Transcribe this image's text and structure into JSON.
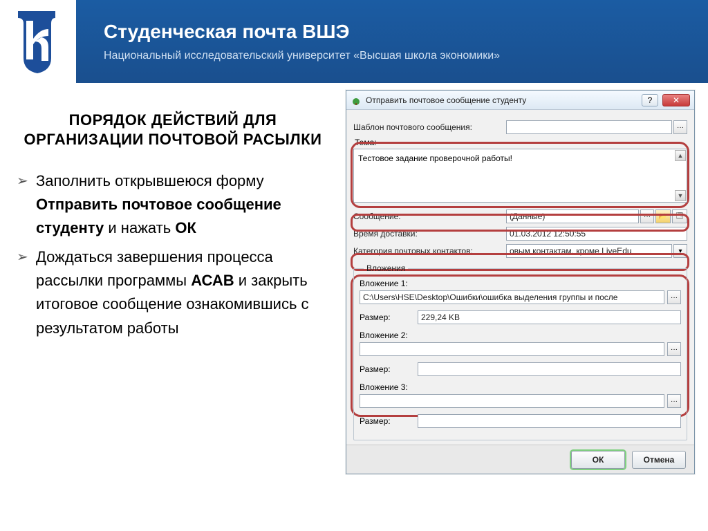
{
  "header": {
    "title": "Студенческая почта ВШЭ",
    "subtitle": "Национальный исследовательский университет «Высшая школа экономики»"
  },
  "left": {
    "heading": "ПОРЯДОК ДЕЙСТВИЙ ДЛЯ ОРГАНИЗАЦИИ ПОЧТОВОЙ РАСЫЛКИ",
    "bullet1_a": "Заполнить открывшеюся форму ",
    "bullet1_b": "Отправить почтовое сообщение студенту",
    "bullet1_c": " и нажать ",
    "bullet1_d": "ОК",
    "bullet2_a": "Дождаться завершения процесса рассылки программы ",
    "bullet2_b": "АСАВ",
    "bullet2_c": "  и закрыть итоговое сообщение ознакомившись с результатом работы"
  },
  "dialog": {
    "title": "Отправить почтовое сообщение студенту",
    "template_label": "Шаблон почтового сообщения:",
    "template_value": "",
    "tema_label": "Тема:",
    "tema_value": "Тестовое задание проверочной работы!",
    "message_label": "Сообщение:",
    "message_value": "(Данные)",
    "delivery_label": "Время доставки:",
    "delivery_value": "01.03.2012 12:50:55",
    "category_label": "Категория почтовых контактов:",
    "category_value": "овым контактам, кроме LiveEdu",
    "attachments_legend": "Вложения",
    "att1_label": "Вложение 1:",
    "att1_value": "C:\\Users\\HSE\\Desktop\\Ошибки\\ошибка выделения группы и после",
    "size_label": "Размер:",
    "att1_size": "229,24 KB",
    "att2_label": "Вложение 2:",
    "att2_value": "",
    "att2_size": "",
    "att3_label": "Вложение 3:",
    "att3_value": "",
    "att3_size": "",
    "ok": "ОК",
    "cancel": "Отмена",
    "ellipsis": "···",
    "dropdown": "▾",
    "help": "?",
    "close": "✕"
  }
}
